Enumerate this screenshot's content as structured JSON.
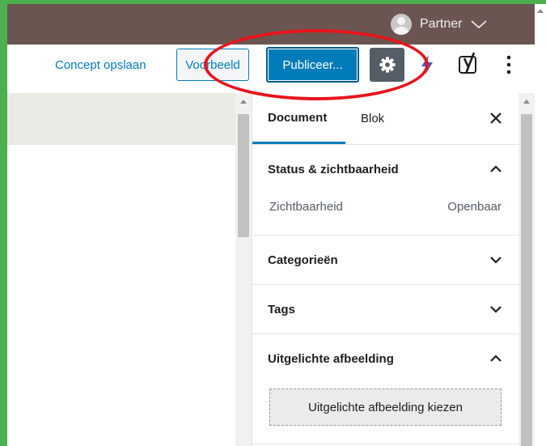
{
  "adminbar": {
    "user_name": "Partner"
  },
  "toolbar": {
    "save_draft_label": "Concept opslaan",
    "preview_label": "Voorbeeld",
    "publish_label": "Publiceer...",
    "settings_icon": "gear-icon",
    "jetpack_icon": "bolt-icon",
    "yoast_icon": "yoast-icon",
    "more_icon": "more-vertical-icon"
  },
  "sidebar": {
    "tabs": [
      {
        "label": "Document",
        "active": true
      },
      {
        "label": "Blok",
        "active": false
      }
    ],
    "panels": {
      "status": {
        "title": "Status & zichtbaarheid",
        "expanded": true,
        "visibility_label": "Zichtbaarheid",
        "visibility_value": "Openbaar"
      },
      "categories": {
        "title": "Categorieën",
        "expanded": false
      },
      "tags": {
        "title": "Tags",
        "expanded": false
      },
      "featured_image": {
        "title": "Uitgelichte afbeelding",
        "expanded": true,
        "button_label": "Uitgelichte afbeelding kiezen"
      }
    }
  },
  "colors": {
    "accent": "#007cba",
    "adminbar": "#6b5550",
    "annotation": "#e8141b",
    "border_frame": "#4caf50"
  }
}
